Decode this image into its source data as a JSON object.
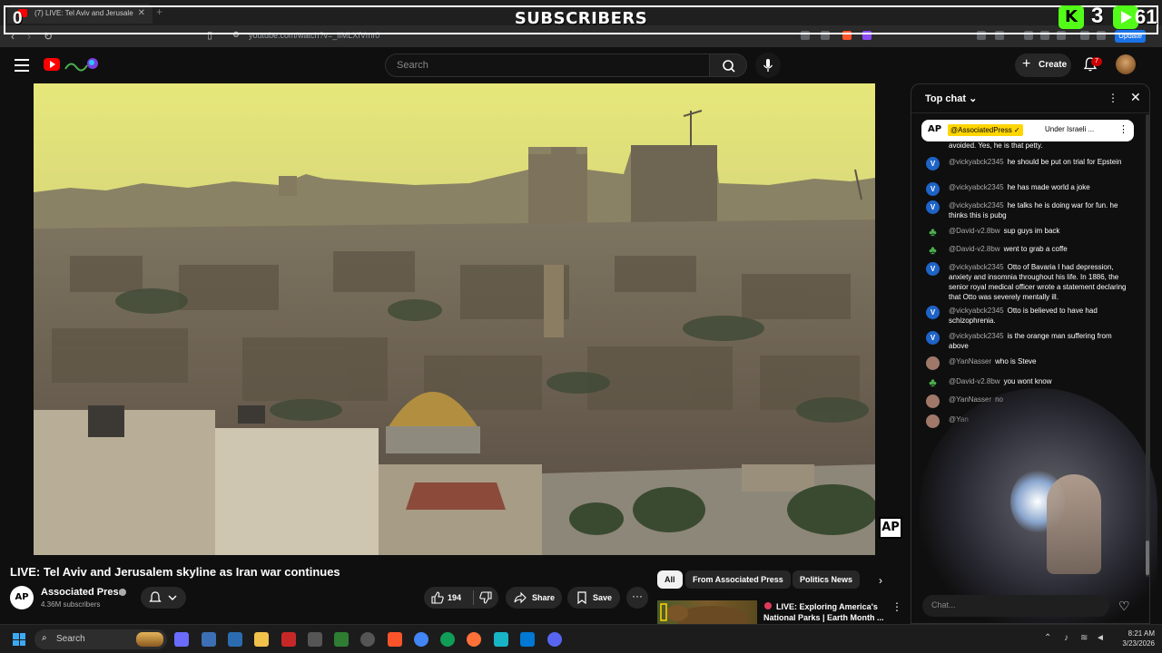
{
  "overlay": {
    "title": "SUBSCRIBERS",
    "left_count": "0",
    "kick_count": "3",
    "play_count": "61"
  },
  "browser": {
    "tab_title": "(7) LIVE: Tel Aviv and Jerusale",
    "url": "youtube.com/watch?v=_iIMLXfVmr0",
    "update_label": "Update"
  },
  "youtube": {
    "search_placeholder": "Search",
    "create_label": "Create",
    "notifications_count": "7"
  },
  "video": {
    "title": "LIVE: Tel Aviv and Jerusalem skyline as Iran war continues",
    "watermark": "AP",
    "channel_name": "Associated Press",
    "channel_avatar_text": "AP",
    "subscribers": "4.36M subscribers",
    "likes": "194",
    "share_label": "Share",
    "save_label": "Save"
  },
  "chips": [
    "All",
    "From Associated Press",
    "Politics News"
  ],
  "recommendation": {
    "title": "LIVE: Exploring America's National Parks | Earth Month ..."
  },
  "chat": {
    "header": "Top chat",
    "pinned_avatar": "AP",
    "pinned_user": "@AssociatedPress ✓",
    "pinned_text": "Under Israeli ...",
    "partial_top": "avoided. Yes, he is that petty.",
    "messages": [
      {
        "user": "@vickyabck2345",
        "text": "he should be put on trial for Epstein",
        "avatar": "V"
      },
      {
        "user": "@vickyabck2345",
        "text": "he has made world a joke",
        "avatar": "V"
      },
      {
        "user": "@vickyabck2345",
        "text": "he talks he is doing war for fun. he thinks this is pubg",
        "avatar": "V"
      },
      {
        "user": "@David-v2.8bw",
        "text": "sup guys im back",
        "avatar": "tree"
      },
      {
        "user": "@David-v2.8bw",
        "text": "went to grab a coffe",
        "avatar": "tree"
      },
      {
        "user": "@vickyabck2345",
        "text": "Otto of Bavaria I had depression, anxiety and insomnia throughout his life. In 1886, the senior royal medical officer wrote a statement declaring that Otto was severely mentally ill.",
        "avatar": "V"
      },
      {
        "user": "@vickyabck2345",
        "text": "Otto is believed to have had schizophrenia.",
        "avatar": "V"
      },
      {
        "user": "@vickyabck2345",
        "text": "is the orange man suffering from above",
        "avatar": "V"
      },
      {
        "user": "@YanNasser",
        "text": "who is Steve",
        "avatar": "yan"
      },
      {
        "user": "@David-v2.8bw",
        "text": "you wont know",
        "avatar": "tree"
      },
      {
        "user": "@YanNasser",
        "text": "no",
        "avatar": "yan"
      },
      {
        "user": "@Yan",
        "text": "",
        "avatar": "yan"
      }
    ],
    "input_placeholder": "Chat..."
  },
  "taskbar": {
    "search_label": "Search",
    "time": "8:21 AM",
    "date": "3/23/2026"
  }
}
